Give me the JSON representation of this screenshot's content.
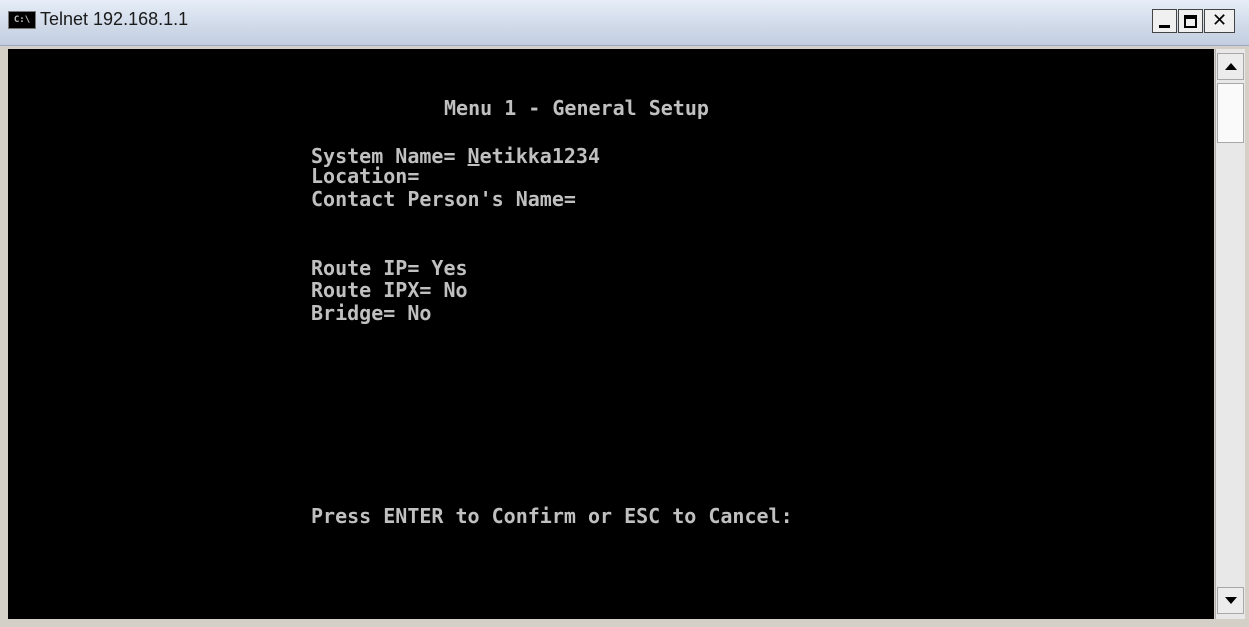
{
  "window": {
    "title": "Telnet 192.168.1.1",
    "icon_label": "C:\\"
  },
  "terminal": {
    "menu_title": "Menu 1 - General Setup",
    "system_name_label": "System Name= ",
    "system_name_cursor_char": "N",
    "system_name_rest": "etikka1234",
    "location_label": "Location=",
    "contact_label": "Contact Person's Name=",
    "route_ip": "Route IP= Yes",
    "route_ipx": "Route IPX= No",
    "bridge": "Bridge= No",
    "prompt": "Press ENTER to Confirm or ESC to Cancel:"
  },
  "colors": {
    "console_bg": "#000000",
    "console_fg": "#c0c0c0"
  }
}
